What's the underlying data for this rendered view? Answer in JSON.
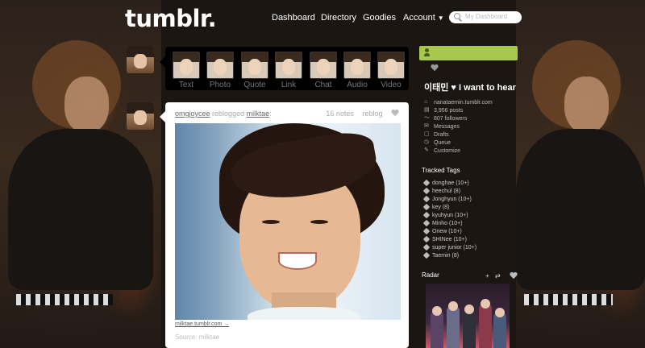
{
  "header": {
    "logo": "tumblr.",
    "nav": {
      "dashboard": "Dashboard",
      "directory": "Directory",
      "goodies": "Goodies",
      "account": "Account"
    },
    "search_placeholder": "My Dashboard"
  },
  "post_types": [
    {
      "label": "Text"
    },
    {
      "label": "Photo"
    },
    {
      "label": "Quote"
    },
    {
      "label": "Link"
    },
    {
      "label": "Chat"
    },
    {
      "label": "Audio"
    },
    {
      "label": "Video"
    }
  ],
  "post": {
    "reblogger": "omgjoycee",
    "action": "reblogged",
    "source_user": "milktae",
    "notes": "16 notes",
    "reblog": "reblog",
    "caption_link": "milktae.tumblr.com →",
    "source_text": "Source: milktae"
  },
  "sidebar": {
    "blog_title": "이태민 ♥ I want to hear your voice",
    "items": [
      {
        "icon": "home-icon",
        "glyph": "⌂",
        "label": "nanataemin.tumblr.com"
      },
      {
        "icon": "posts-icon",
        "glyph": "▤",
        "label": "3,956 posts"
      },
      {
        "icon": "followers-icon",
        "glyph": "〜",
        "label": "807 followers"
      },
      {
        "icon": "messages-icon",
        "glyph": "✉",
        "label": "Messages"
      },
      {
        "icon": "drafts-icon",
        "glyph": "▢",
        "label": "Drafts"
      },
      {
        "icon": "queue-icon",
        "glyph": "◷",
        "label": "Queue"
      },
      {
        "icon": "customize-icon",
        "glyph": "✎",
        "label": "Customize"
      }
    ],
    "tracked_tags_title": "Tracked Tags",
    "tracked_tags": [
      {
        "label": "donghae (10+)"
      },
      {
        "label": "heechul (8)"
      },
      {
        "label": "Jonghyun (10+)"
      },
      {
        "label": "key (8)"
      },
      {
        "label": "kyuhyun (10+)"
      },
      {
        "label": "Minho (10+)"
      },
      {
        "label": "Onew (10+)"
      },
      {
        "label": "SHINee (10+)"
      },
      {
        "label": "super junior (10+)"
      },
      {
        "label": "Taemin (8)"
      }
    ],
    "radar_title": "Radar"
  }
}
